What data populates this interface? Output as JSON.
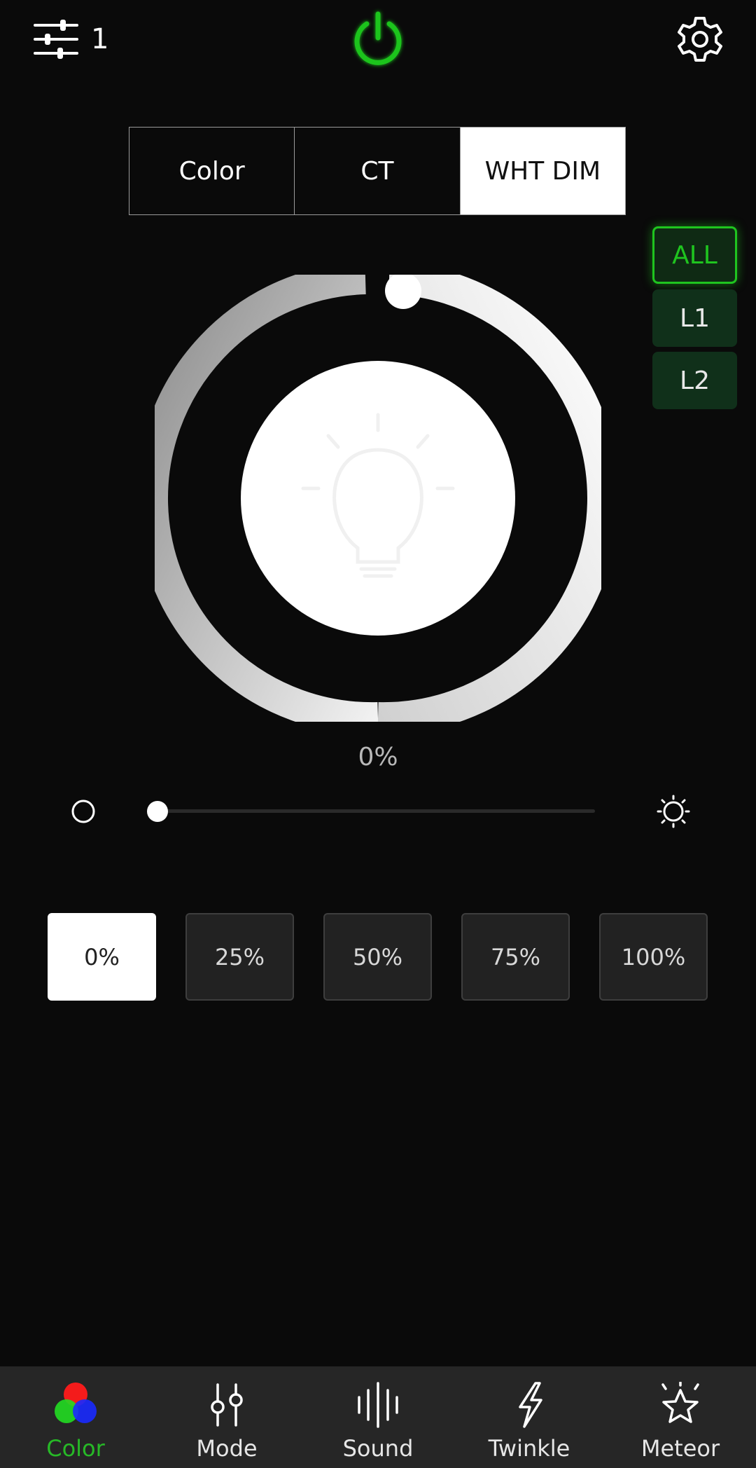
{
  "header": {
    "group_number": "1",
    "power_color": "#1fc41f",
    "filter_icon": "sliders-icon",
    "settings_icon": "gear-icon"
  },
  "tabs": [
    {
      "label": "Color",
      "active": false
    },
    {
      "label": "CT",
      "active": false
    },
    {
      "label": "WHT DIM",
      "active": true
    }
  ],
  "zones": [
    {
      "label": "ALL",
      "active": true
    },
    {
      "label": "L1",
      "active": false
    },
    {
      "label": "L2",
      "active": false
    }
  ],
  "brightness": {
    "value_label": "0%",
    "value": 0
  },
  "presets": [
    {
      "label": "0%",
      "active": true
    },
    {
      "label": "25%",
      "active": false
    },
    {
      "label": "50%",
      "active": false
    },
    {
      "label": "75%",
      "active": false
    },
    {
      "label": "100%",
      "active": false
    }
  ],
  "bottom_nav": [
    {
      "label": "Color",
      "icon": "rgb-circles-icon",
      "active": true
    },
    {
      "label": "Mode",
      "icon": "mode-sliders-icon",
      "active": false
    },
    {
      "label": "Sound",
      "icon": "sound-wave-icon",
      "active": false
    },
    {
      "label": "Twinkle",
      "icon": "lightning-icon",
      "active": false
    },
    {
      "label": "Meteor",
      "icon": "star-icon",
      "active": false
    }
  ],
  "colors": {
    "accent": "#1fc41f",
    "background": "#0a0a0a",
    "nav_background": "#262626"
  }
}
